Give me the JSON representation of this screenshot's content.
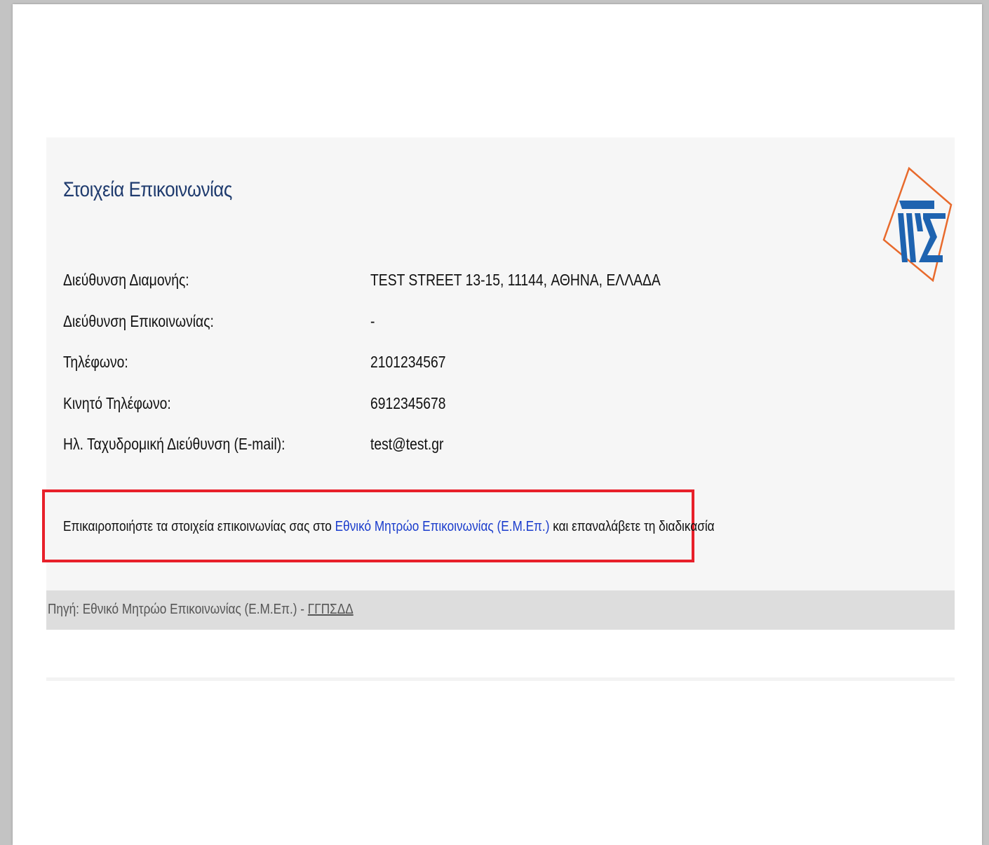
{
  "card": {
    "title": "Στοιχεία Επικοινωνίας"
  },
  "rows": [
    {
      "label": "Διεύθυνση Διαμονής:",
      "value": "TEST STREET 13-15, 11144, ΑΘΗΝΑ, ΕΛΛΑΔΑ"
    },
    {
      "label": "Διεύθυνση Επικοινωνίας:",
      "value": "-"
    },
    {
      "label": "Τηλέφωνο:",
      "value": "2101234567"
    },
    {
      "label": "Κινητό Τηλέφωνο:",
      "value": "6912345678"
    },
    {
      "label": "Ηλ. Ταχυδρομική Διεύθυνση (E-mail):",
      "value": "test@test.gr"
    }
  ],
  "notice": {
    "prefix": "Επικαιροποιήστε τα στοιχεία επικοινωνίας σας στο ",
    "link": "Εθνικό Μητρώο Επικοινωνίας (Ε.Μ.Επ.)",
    "suffix": " και επαναλάβετε τη διαδικασία",
    "link_color": "#1a3ccc",
    "border_color": "#e8202a"
  },
  "footer": {
    "source": "Πηγή: Εθνικό Μητρώο Επικοινωνίας (Ε.Μ.Επ.) - ",
    "abbr": "ΓΓΠΣΔΔ"
  },
  "colors": {
    "title": "#1f3b6e",
    "logo_blue": "#1e63b0",
    "logo_orange": "#e86a2c",
    "card_bg": "#f6f6f6",
    "footer_bg": "#dddddd"
  },
  "icons": {
    "logo": "gsis-logo-icon"
  }
}
